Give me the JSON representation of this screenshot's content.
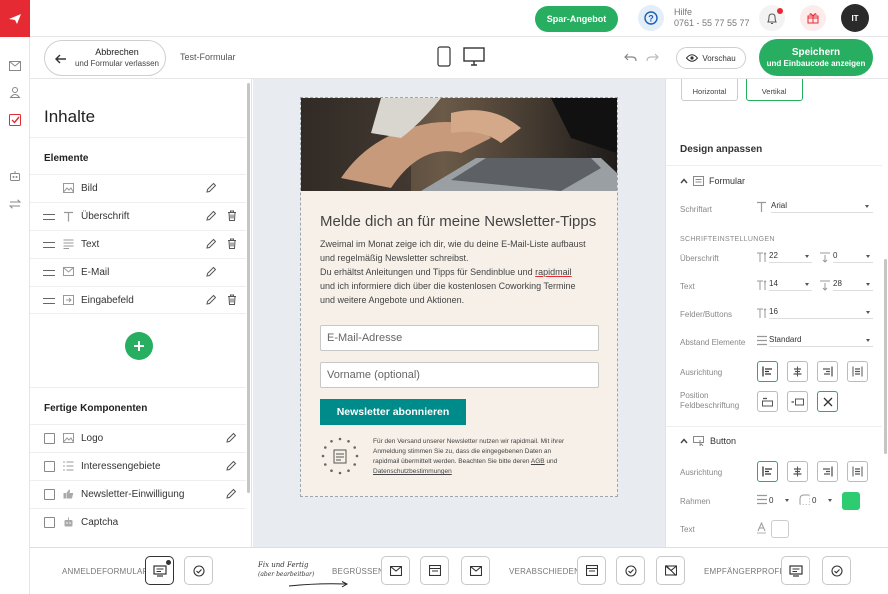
{
  "topbar": {
    "offer_label": "Spar-Angebot",
    "help_title": "Hilfe",
    "help_phone": "0761 - 55 77 55 77",
    "avatar_initials": "IT"
  },
  "toolbar": {
    "cancel_line1": "Abbrechen",
    "cancel_line2": "und Formular verlassen",
    "form_name": "Test-Formular",
    "preview_label": "Vorschau",
    "save_line1": "Speichern",
    "save_line2": "und Einbaucode anzeigen"
  },
  "left_panel": {
    "title": "Inhalte",
    "elements_heading": "Elemente",
    "elements": [
      {
        "label": "Bild",
        "icon": "image-icon",
        "deletable": false
      },
      {
        "label": "Überschrift",
        "icon": "text-t-icon",
        "deletable": true
      },
      {
        "label": "Text",
        "icon": "paragraph-icon",
        "deletable": true
      },
      {
        "label": "E-Mail",
        "icon": "envelope-icon",
        "deletable": false
      },
      {
        "label": "Eingabefeld",
        "icon": "input-field-icon",
        "deletable": true
      }
    ],
    "components_heading": "Fertige Komponenten",
    "components": [
      {
        "label": "Logo",
        "icon": "image-icon"
      },
      {
        "label": "Interessengebiete",
        "icon": "list-icon"
      },
      {
        "label": "Newsletter-Einwilligung",
        "icon": "thumbs-up-icon"
      },
      {
        "label": "Captcha",
        "icon": "robot-icon"
      }
    ]
  },
  "form_preview": {
    "heading": "Melde dich an für meine Newsletter-Tipps",
    "body_line1": "Zweimal im Monat zeige ich dir, wie du deine E-Mail-Liste aufbaust",
    "body_line2": "und regelmäßig Newsletter schreibst.",
    "body_line3_pre": "Du erhältst Anleitungen und Tipps für Sendinblue und ",
    "body_line3_link": "rapidmail",
    "body_line4": "und ich informiere dich über die kostenlosen Coworking Termine",
    "body_line5": "und weitere Angebote und Aktionen.",
    "email_placeholder": "E-Mail-Adresse",
    "firstname_placeholder": "Vorname (optional)",
    "submit_label": "Newsletter abonnieren",
    "legal_line1": "Für den Versand unserer Newsletter nutzen wir rapidmail. Mit ihrer",
    "legal_line2": "Anmeldung stimmen Sie zu, dass die eingegebenen Daten an",
    "legal_line3_pre": "rapidmail übermittelt werden. Beachten Sie bitte deren ",
    "legal_agb": "AGB",
    "legal_und": " und",
    "legal_privacy": "Datenschutzbestimmungen",
    "accent_color": "#008b8b"
  },
  "right_panel": {
    "layout_horizontal": "Horizontal",
    "layout_vertical": "Vertikal",
    "design_heading": "Design anpassen",
    "formular_section": "Formular",
    "font_label": "Schriftart",
    "font_value": "Arial",
    "font_settings_heading": "SCHRIFTEINSTELLUNGEN",
    "heading_label": "Überschrift",
    "heading_size": "22",
    "heading_spacing": "0",
    "text_label": "Text",
    "text_size": "14",
    "text_spacing": "28",
    "fields_label": "Felder/Buttons",
    "fields_size": "16",
    "spacing_label": "Abstand Elemente",
    "spacing_value": "Standard",
    "align_label": "Ausrichtung",
    "position_label_1": "Position",
    "position_label_2": "Feldbeschriftung",
    "button_section": "Button",
    "button_align_label": "Ausrichtung",
    "frame_label": "Rahmen",
    "frame_width": "0",
    "frame_radius": "0",
    "frame_color": "#2ecc71",
    "button_text_label": "Text"
  },
  "bottom_bar": {
    "step1": "ANMELDEFORMULAR",
    "step2": "BEGRÜSSEN",
    "step3": "VERABSCHIEDEN",
    "step4": "EMPFÄNGERPROFIL",
    "handwritten_1": "Fix und Fertig",
    "handwritten_2": "(aber bearbeitbar)"
  }
}
